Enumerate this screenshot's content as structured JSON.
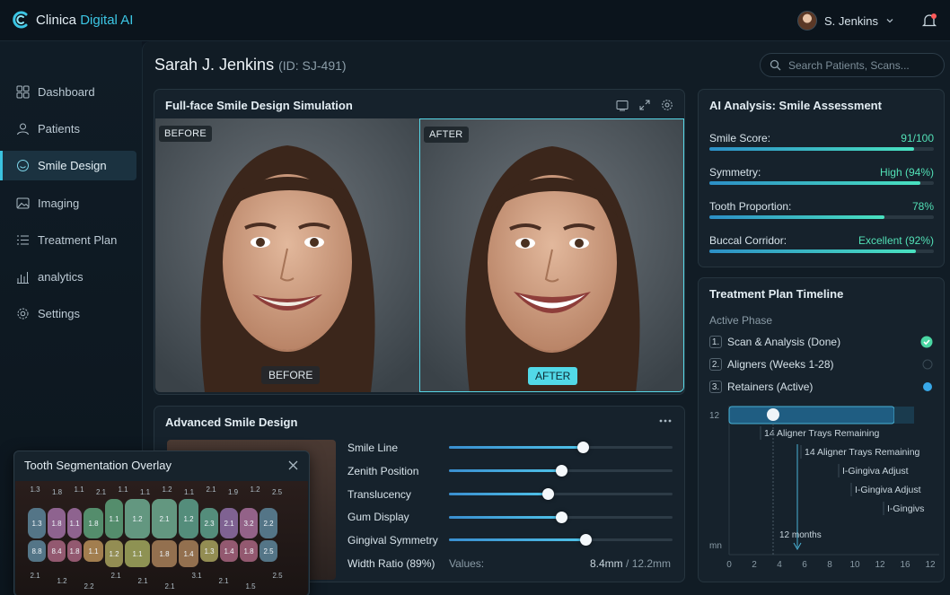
{
  "app": {
    "name_prefix": "Clinica",
    "name_accent": "Digital AI"
  },
  "user": {
    "name": "S. Jenkins"
  },
  "nav": [
    {
      "label": "Dashboard",
      "icon": "dashboard-icon"
    },
    {
      "label": "Patients",
      "icon": "patients-icon"
    },
    {
      "label": "Smile Design",
      "icon": "smile-icon",
      "active": true
    },
    {
      "label": "Imaging",
      "icon": "image-icon"
    },
    {
      "label": "Treatment Plan",
      "icon": "list-icon"
    },
    {
      "label": "analytics",
      "icon": "chart-icon"
    },
    {
      "label": "Settings",
      "icon": "gear-icon"
    }
  ],
  "patient": {
    "name": "Sarah J. Jenkins",
    "id": "(ID: SJ-491)"
  },
  "search": {
    "placeholder": "Search Patients, Scans..."
  },
  "simulation": {
    "title": "Full-face Smile Design Simulation",
    "before_tag": "BEFORE",
    "after_tag": "AFTER",
    "before_button": "BEFORE",
    "after_button": "AFTER"
  },
  "analysis": {
    "title": "AI Analysis: Smile Assessment",
    "metrics": [
      {
        "label": "Smile Score:",
        "value": "91/100",
        "fraction": 0.91
      },
      {
        "label": "Symmetry:",
        "value": "High (94%)",
        "fraction": 0.94
      },
      {
        "label": "Tooth Proportion:",
        "value": "78%",
        "fraction": 0.78
      },
      {
        "label": "Buccal Corridor:",
        "value": "Excellent (92%)",
        "fraction": 0.92
      }
    ]
  },
  "timeline": {
    "title": "Treatment Plan Timeline",
    "active_phase_label": "Active Phase",
    "phases": [
      {
        "num": "1.",
        "label": "Scan & Analysis (Done)",
        "status": "done"
      },
      {
        "num": "2.",
        "label": "Aligners (Weeks 1-28)",
        "status": "pending"
      },
      {
        "num": "3.",
        "label": "Retainers (Active)",
        "status": "active"
      }
    ],
    "chart": {
      "y_top_label": "12",
      "y_bottom_label": "mn",
      "x_ticks": [
        "0",
        "2",
        "4",
        "6",
        "8",
        "10",
        "12",
        "16",
        "12"
      ],
      "annotations": [
        "14 Aligner Trays Remaining",
        "14 Aligner Trays Remaining",
        "I-Gingiva Adjust",
        "I-Gingiva Adjust",
        "I-Gingivs"
      ],
      "marker_label": "12 months"
    }
  },
  "advanced": {
    "title": "Advanced Smile Design",
    "sliders": [
      {
        "label": "Smile Line",
        "level": 0.6
      },
      {
        "label": "Zenith Position",
        "level": 0.5
      },
      {
        "label": "Translucency",
        "level": 0.44
      },
      {
        "label": "Gum Display",
        "level": 0.5
      },
      {
        "label": "Gingival Symmetry",
        "level": 0.61
      }
    ],
    "width_ratio_label": "Width Ratio (89%)",
    "values_label": "Values:",
    "values": "8.4mm",
    "values_sep": "/ 12.2mm"
  },
  "segmentation": {
    "title": "Tooth Segmentation Overlay",
    "upper": [
      {
        "v": "1.3",
        "c": "#5a7f93"
      },
      {
        "v": "1.8",
        "c": "#9a6c9c"
      },
      {
        "v": "1.1",
        "c": "#9a6c9c"
      },
      {
        "v": "1.8",
        "c": "#5a9a75"
      },
      {
        "v": "1.1",
        "c": "#5a9a75"
      },
      {
        "v": "1.2",
        "c": "#6aa58c"
      },
      {
        "v": "2.1",
        "c": "#6aa58c"
      },
      {
        "v": "1.2",
        "c": "#5a9a86"
      },
      {
        "v": "2.3",
        "c": "#5a9a86"
      },
      {
        "v": "2.1",
        "c": "#8a6aa0"
      },
      {
        "v": "3.2",
        "c": "#a06a95"
      },
      {
        "v": "2.2",
        "c": "#5a7f93"
      }
    ],
    "lower": [
      {
        "v": "8.8",
        "c": "#5a7f93"
      },
      {
        "v": "8.4",
        "c": "#a0607a"
      },
      {
        "v": "1.8",
        "c": "#a0607a"
      },
      {
        "v": "1.1",
        "c": "#b08a55"
      },
      {
        "v": "1.2",
        "c": "#a09a5a"
      },
      {
        "v": "1.1",
        "c": "#9aa05a"
      },
      {
        "v": "1.8",
        "c": "#a07a55"
      },
      {
        "v": "1.4",
        "c": "#a07a55"
      },
      {
        "v": "1.3",
        "c": "#a09a5a"
      },
      {
        "v": "1.4",
        "c": "#a0607a"
      },
      {
        "v": "1.8",
        "c": "#a0607a"
      },
      {
        "v": "2.5",
        "c": "#5a7f93"
      }
    ],
    "top_labels": [
      "1.3",
      "1.8",
      "1.1",
      "2.1",
      "1.1",
      "1.1",
      "1.2",
      "1.1",
      "2.1",
      "1.9",
      "1.2",
      "2.5"
    ],
    "bottom_labels": [
      "2.1",
      "1.2",
      "2.2",
      "2.1",
      "2.1",
      "2.1",
      "3.1",
      "2.1",
      "1.5",
      "2.5"
    ]
  },
  "colors": {
    "accent": "#3cc6e4",
    "good": "#52e0b6"
  }
}
